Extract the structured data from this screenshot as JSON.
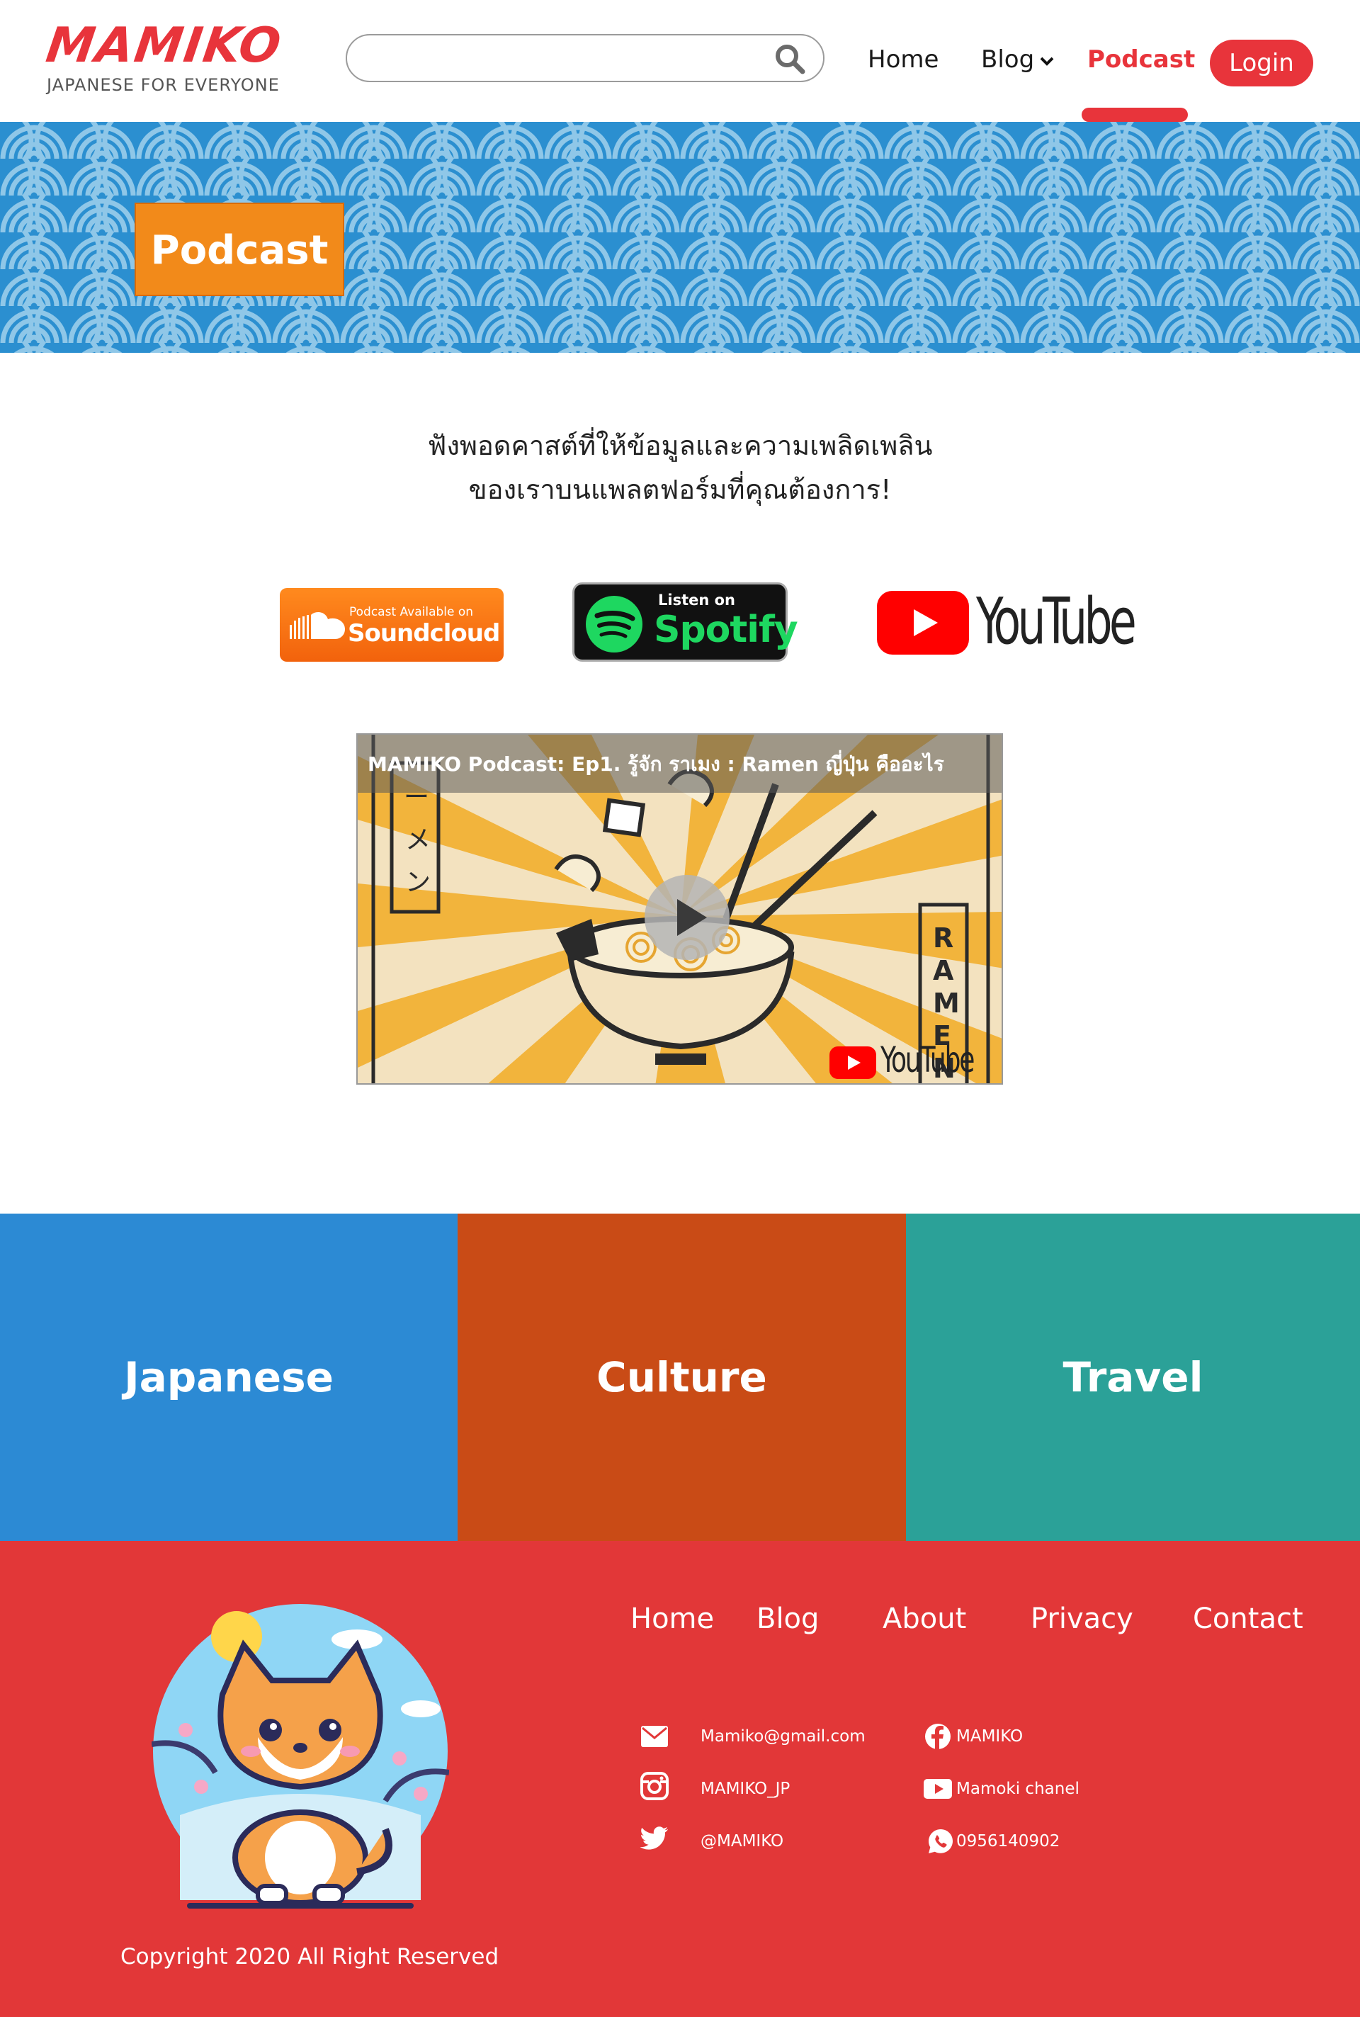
{
  "header": {
    "logo_text": "MAMIKO",
    "tagline": "JAPANESE FOR EVERYONE",
    "search": {
      "value": "",
      "placeholder": "",
      "icon": "search-icon"
    },
    "nav": {
      "home": "Home",
      "blog": "Blog",
      "podcast": "Podcast",
      "login": "Login",
      "active": "Podcast"
    }
  },
  "banner": {
    "title": "Podcast"
  },
  "intro": {
    "line1": "ฟังพอดคาสต์ที่ให้ข้อมูลและความเพลิดเพลิน",
    "line2": "ของเราบนแพลตฟอร์มที่คุณต้องการ!"
  },
  "platforms": {
    "soundcloud": {
      "small": "Podcast Available on",
      "big": "Soundcloud"
    },
    "spotify": {
      "small": "Listen on",
      "big": "Spotify"
    },
    "youtube": {
      "word": "YouTube"
    }
  },
  "video": {
    "title": "MAMIKO Podcast: Ep1. รู้จัก ราเมง : Ramen ญี่ปุ่น คืออะไร",
    "brand": "YouTube",
    "art_text_vertical_left": "ーメン",
    "art_text_vertical_right": "RAMEN"
  },
  "categories": [
    {
      "label": "Japanese",
      "color": "#2c8ad4"
    },
    {
      "label": "Culture",
      "color": "#c94b16"
    },
    {
      "label": "Travel",
      "color": "#2ba198"
    }
  ],
  "footer": {
    "nav": {
      "home": "Home",
      "blog": "Blog",
      "about": "About",
      "privacy": "Privacy",
      "contact": "Contact"
    },
    "contacts": {
      "email": "Mamiko@gmail.com",
      "instagram": "MAMIKO_JP",
      "twitter": "@MAMIKO",
      "facebook": "MAMIKO",
      "youtube": "Mamoki chanel",
      "phone": "0956140902"
    },
    "copyright": "Copyright 2020 All Right Reserved"
  },
  "colors": {
    "brand_red": "#e8343b",
    "footer_red": "#e23738",
    "banner_blue": "#2b8fd0",
    "banner_title_orange": "#f28a1a"
  }
}
